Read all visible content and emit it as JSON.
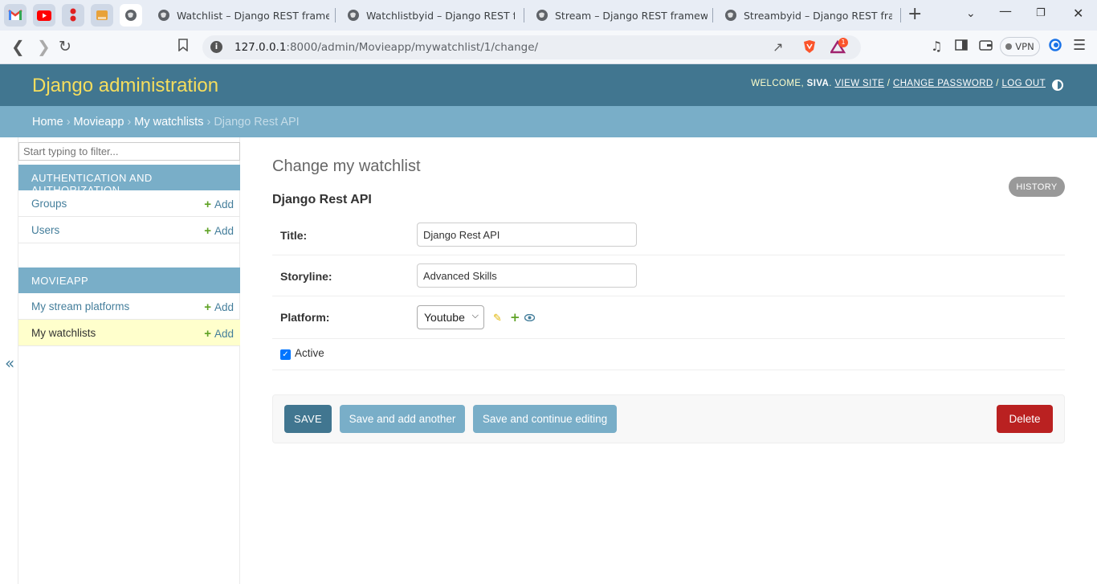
{
  "browser": {
    "tabs": [
      {
        "title": "Watchlist – Django REST framework"
      },
      {
        "title": "Watchlistbyid – Django REST framework"
      },
      {
        "title": "Stream – Django REST framework"
      },
      {
        "title": "Streambyid – Django REST framework"
      }
    ],
    "url_host": "127.0.0.1",
    "url_path": ":8000/admin/Movieapp/mywatchlist/1/change/",
    "vpn_label": "VPN",
    "alert_count": "1"
  },
  "header": {
    "brand": "Django administration",
    "welcome": "WELCOME,",
    "username": "SIVA",
    "view_site": "VIEW SITE",
    "change_password": "CHANGE PASSWORD",
    "log_out": "LOG OUT"
  },
  "breadcrumbs": {
    "home": "Home",
    "app": "Movieapp",
    "model": "My watchlists",
    "current": "Django Rest API"
  },
  "sidebar": {
    "filter_placeholder": "Start typing to filter...",
    "modules": [
      {
        "caption": "AUTHENTICATION AND AUTHORIZATION",
        "models": [
          {
            "name": "Groups",
            "add": "Add"
          },
          {
            "name": "Users",
            "add": "Add"
          }
        ]
      },
      {
        "caption": "MOVIEAPP",
        "models": [
          {
            "name": "My stream platforms",
            "add": "Add"
          },
          {
            "name": "My watchlists",
            "add": "Add"
          }
        ]
      }
    ],
    "collapse_glyph": "«"
  },
  "content": {
    "title": "Change my watchlist",
    "history": "HISTORY",
    "object_title": "Django Rest API",
    "fields": {
      "title_label": "Title:",
      "title_value": "Django Rest API",
      "storyline_label": "Storyline:",
      "storyline_value": "Advanced Skills",
      "platform_label": "Platform:",
      "platform_value": "Youtube",
      "active_label": "Active",
      "active_checked": true
    },
    "buttons": {
      "save": "SAVE",
      "save_add_another": "Save and add another",
      "save_continue": "Save and continue editing",
      "delete": "Delete"
    }
  },
  "colors": {
    "header": "#417690",
    "brand": "#f5dd5d",
    "breadcrumb_bar": "#79aec8",
    "delete": "#ba2121",
    "selected_row": "#ffffcc"
  }
}
